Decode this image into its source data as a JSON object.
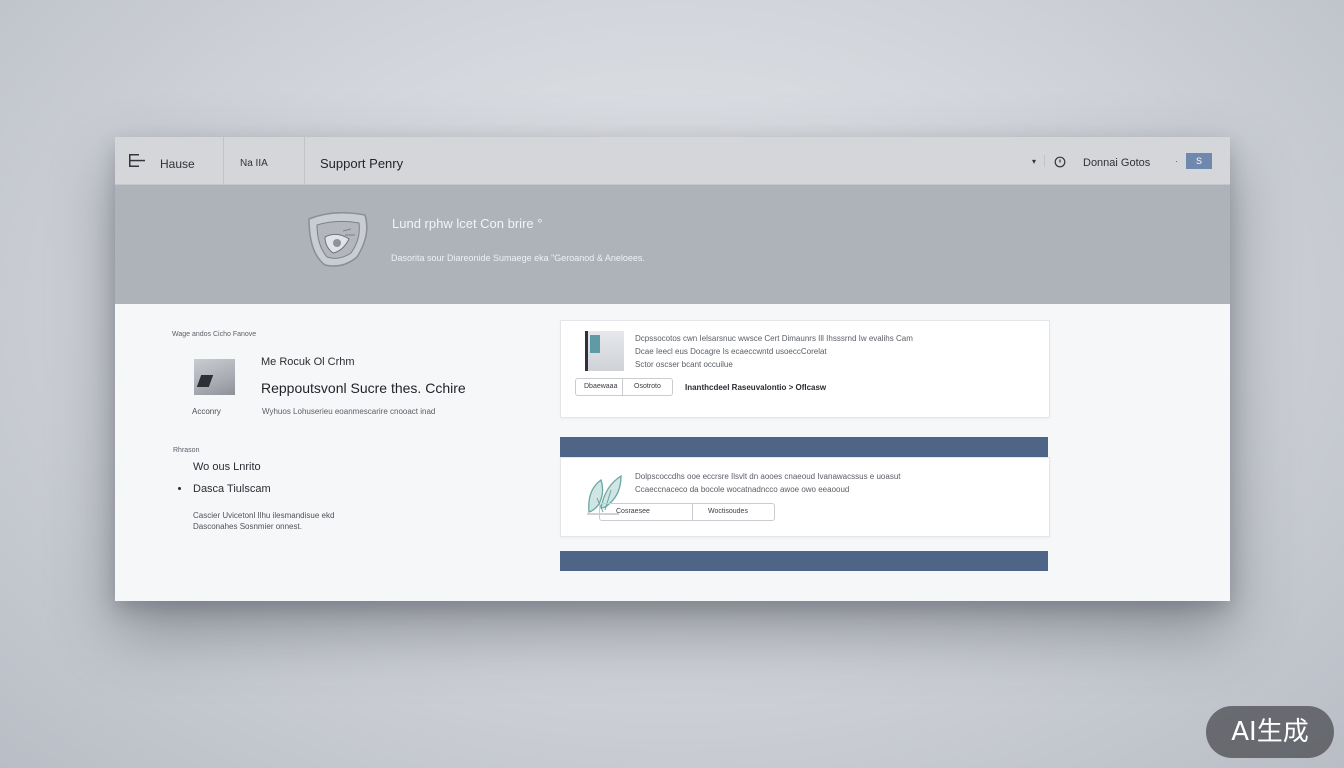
{
  "topbar": {
    "home": "Hause",
    "nav_item": "Na IIA",
    "title": "Support Penry",
    "account": "Donnai Gotos",
    "caret": "▾",
    "button": "S"
  },
  "hero": {
    "title": "Lund rphw lcet Con brire °",
    "subtitle": "Dasorita sour Diareonide Sumaege eka \"Geroanod & Aneloees."
  },
  "left": {
    "section1_label": "Wage andos Cicho Fanove",
    "item_small": "Me Rocuk Ol Crhm",
    "item_title": "Reppoutsvonl Sucre thes. Cchire",
    "item_desc": "Wyhuos Lohuserieu eoanmescarire cnooact inad",
    "thumb_caption": "Acconry",
    "section2_label": "Rhrason",
    "link1": "Wo ous Lnrito",
    "link2": "Dasca Tiulscam",
    "note_line1": "Cascier Uvicetonl Ilhu ilesmandisue ekd",
    "note_line2": "Dasconahes Sosnmier onnest."
  },
  "card1": {
    "line1": "Dcpssocotos cwn Ielsarsnuc wwsce Cert Dimaunrs Ill Ihsssrnd Iw evalihs Cam",
    "line2": "Dcae Ieecl eus Docagre Is ecaeccwntd usoeccCorelat",
    "line3": "Sctor oscser bcant occuilue",
    "pill_left": "Dbaewaaa",
    "pill_right": "Osotroto",
    "link": "Inanthcdeel Raseuvalontio > Oflcasw"
  },
  "card2": {
    "line1": "Dolpscoccdhs ooe eccrsre Ilsvlt dn aooes cnaeoud Ivanawacssus e uoasut",
    "line2": "Ccaeccnaceco da bocole wocatnadncco awoe owo eeaooud",
    "pill_left": "Cosraesee",
    "pill_right": "Woctisoudes"
  },
  "badge": {
    "text": "AI生成"
  },
  "colors": {
    "accent_bar": "#4f6587",
    "button": "#6f88ad",
    "hero_bg": "#aeb2b9",
    "topbar_bg": "#d4d6da"
  },
  "icons": {
    "logo": "grid-logo-icon",
    "search": "search-icon",
    "hero": "spaceship-illustration-icon",
    "leaf": "leaf-illustration-icon"
  }
}
